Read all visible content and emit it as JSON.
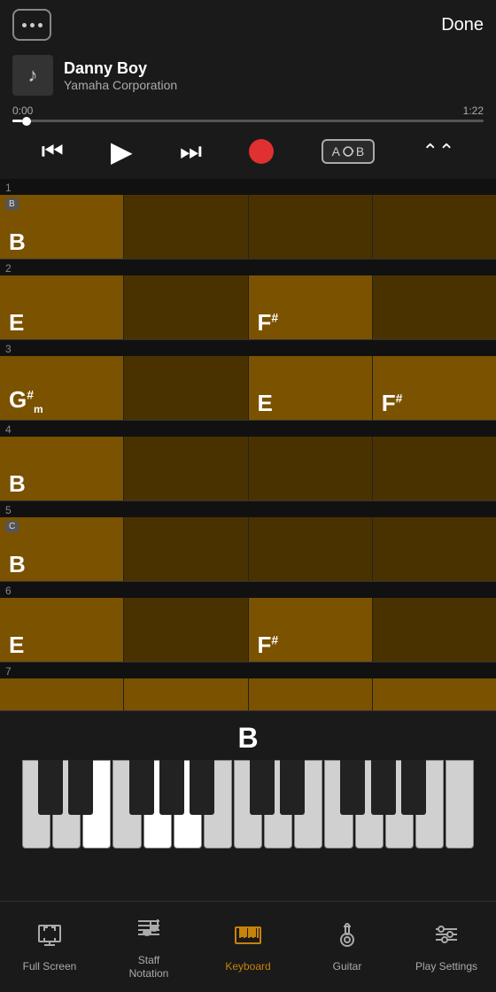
{
  "header": {
    "menu_label": "menu",
    "done_label": "Done"
  },
  "song": {
    "title": "Danny Boy",
    "artist": "Yamaha Corporation"
  },
  "player": {
    "current_time": "0:00",
    "total_time": "1:22",
    "progress_pct": 2,
    "ab_label": "A B"
  },
  "chord_rows": [
    {
      "number": "1",
      "cells": [
        {
          "chord": "B",
          "modifier": "",
          "sub": "",
          "dark": false,
          "section": "B"
        },
        {
          "chord": "",
          "modifier": "",
          "sub": "",
          "dark": true,
          "section": ""
        },
        {
          "chord": "",
          "modifier": "",
          "sub": "",
          "dark": true,
          "section": ""
        },
        {
          "chord": "",
          "modifier": "",
          "sub": "",
          "dark": true,
          "section": ""
        }
      ]
    },
    {
      "number": "2",
      "cells": [
        {
          "chord": "E",
          "modifier": "",
          "sub": "",
          "dark": false,
          "section": ""
        },
        {
          "chord": "",
          "modifier": "",
          "sub": "",
          "dark": true,
          "section": ""
        },
        {
          "chord": "F",
          "modifier": "#",
          "sub": "",
          "dark": false,
          "section": ""
        },
        {
          "chord": "",
          "modifier": "",
          "sub": "",
          "dark": true,
          "section": ""
        }
      ]
    },
    {
      "number": "3",
      "cells": [
        {
          "chord": "G",
          "modifier": "#",
          "sub": "m",
          "dark": false,
          "section": ""
        },
        {
          "chord": "",
          "modifier": "",
          "sub": "",
          "dark": true,
          "section": ""
        },
        {
          "chord": "E",
          "modifier": "",
          "sub": "",
          "dark": false,
          "section": ""
        },
        {
          "chord": "F",
          "modifier": "#",
          "sub": "",
          "dark": false,
          "section": ""
        }
      ]
    },
    {
      "number": "4",
      "cells": [
        {
          "chord": "B",
          "modifier": "",
          "sub": "",
          "dark": false,
          "section": ""
        },
        {
          "chord": "",
          "modifier": "",
          "sub": "",
          "dark": true,
          "section": ""
        },
        {
          "chord": "",
          "modifier": "",
          "sub": "",
          "dark": true,
          "section": ""
        },
        {
          "chord": "",
          "modifier": "",
          "sub": "",
          "dark": true,
          "section": ""
        }
      ]
    },
    {
      "number": "5",
      "cells": [
        {
          "chord": "B",
          "modifier": "",
          "sub": "",
          "dark": false,
          "section": "C"
        },
        {
          "chord": "",
          "modifier": "",
          "sub": "",
          "dark": true,
          "section": ""
        },
        {
          "chord": "",
          "modifier": "",
          "sub": "",
          "dark": true,
          "section": ""
        },
        {
          "chord": "",
          "modifier": "",
          "sub": "",
          "dark": true,
          "section": ""
        }
      ]
    },
    {
      "number": "6",
      "cells": [
        {
          "chord": "E",
          "modifier": "",
          "sub": "",
          "dark": false,
          "section": ""
        },
        {
          "chord": "",
          "modifier": "",
          "sub": "",
          "dark": true,
          "section": ""
        },
        {
          "chord": "F",
          "modifier": "#",
          "sub": "",
          "dark": false,
          "section": ""
        },
        {
          "chord": "",
          "modifier": "",
          "sub": "",
          "dark": true,
          "section": ""
        }
      ]
    },
    {
      "number": "7",
      "cells": [
        {
          "chord": "",
          "modifier": "",
          "sub": "",
          "dark": false,
          "section": ""
        },
        {
          "chord": "",
          "modifier": "",
          "sub": "",
          "dark": false,
          "section": ""
        },
        {
          "chord": "",
          "modifier": "",
          "sub": "",
          "dark": false,
          "section": ""
        },
        {
          "chord": "",
          "modifier": "",
          "sub": "",
          "dark": false,
          "section": ""
        }
      ]
    }
  ],
  "current_chord": "B",
  "bottom_nav": {
    "items": [
      {
        "id": "fullscreen",
        "label": "Full Screen",
        "active": false
      },
      {
        "id": "staffnotation",
        "label": "Staff\nNotation",
        "active": false
      },
      {
        "id": "keyboard",
        "label": "Keyboard",
        "active": true
      },
      {
        "id": "guitar",
        "label": "Guitar",
        "active": false
      },
      {
        "id": "playsettings",
        "label": "Play Settings",
        "active": false
      }
    ]
  }
}
